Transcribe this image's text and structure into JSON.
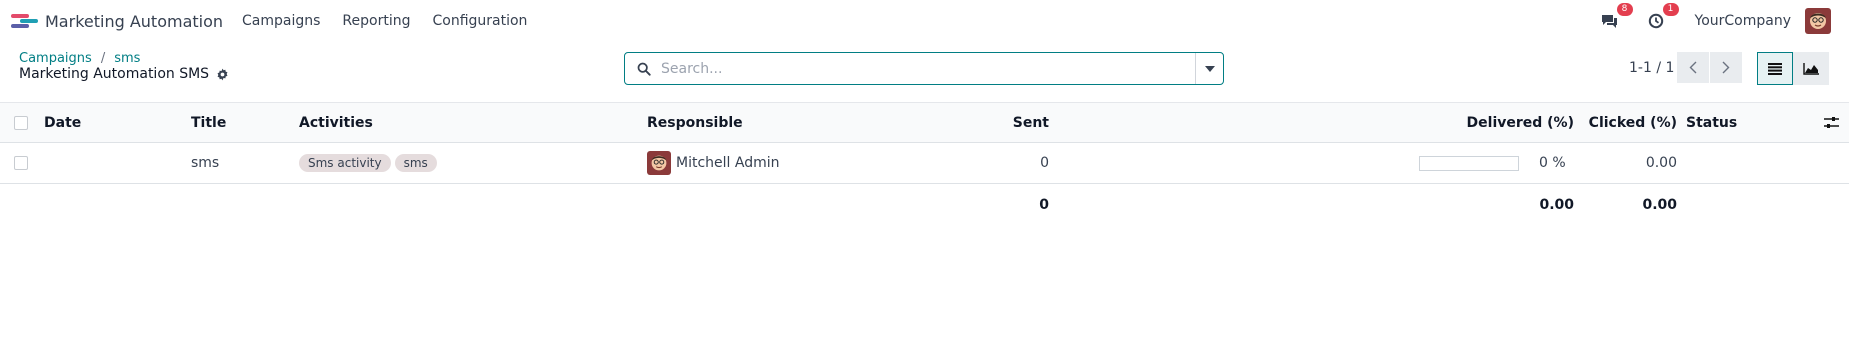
{
  "navbar": {
    "app_name": "Marketing Automation",
    "menu": [
      "Campaigns",
      "Reporting",
      "Configuration"
    ],
    "messages_badge": "8",
    "activities_badge": "1",
    "company": "YourCompany"
  },
  "control_panel": {
    "breadcrumb": [
      "Campaigns",
      "sms"
    ],
    "title": "Marketing Automation SMS",
    "search_placeholder": "Search...",
    "pager": "1-1 / 1"
  },
  "table": {
    "columns": {
      "date": "Date",
      "title": "Title",
      "activities": "Activities",
      "responsible": "Responsible",
      "sent": "Sent",
      "delivered": "Delivered (%)",
      "clicked": "Clicked (%)",
      "status": "Status"
    },
    "rows": [
      {
        "date": "",
        "title": "sms",
        "activities": [
          "Sms activity",
          "sms"
        ],
        "responsible": "Mitchell Admin",
        "sent": "0",
        "delivered_pct": "0 %",
        "delivered_value": 0,
        "clicked": "0.00",
        "status": ""
      }
    ],
    "totals": {
      "sent": "0",
      "delivered": "0.00",
      "clicked": "0.00"
    }
  },
  "colors": {
    "accent": "#017e84",
    "badge": "#e33e4f",
    "tag": "#e5dcdd"
  },
  "icons": [
    "odoo-logo-icon",
    "chat-icon",
    "clock-icon",
    "user-avatar",
    "gear-icon",
    "search-icon",
    "caret-down-icon",
    "chevron-left-icon",
    "chevron-right-icon",
    "list-view-icon",
    "graph-view-icon",
    "column-settings-icon"
  ]
}
